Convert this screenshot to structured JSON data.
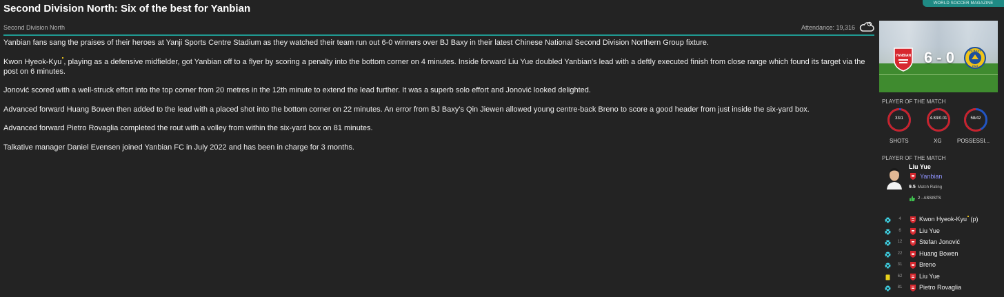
{
  "header": {
    "title": "Second Division North: Six of the best for Yanbian",
    "magazine_tag": "WORLD SOCCER MAGAZINE",
    "competition": "Second Division North",
    "attendance": "Attendance: 19,316",
    "weather_icon": "cloudy-weather-icon"
  },
  "article": {
    "paragraphs": [
      "Yanbian fans sang the praises of their heroes at Yanji Sports Centre Stadium as they watched their team run out 6-0 winners over BJ Baxy in their latest Chinese National Second Division Northern Group fixture.",
      {
        "before": "Kwon Hyeok-Kyu",
        "after": ", playing as a defensive midfielder, got Yanbian off to a flyer by scoring a penalty into the bottom corner on 4 minutes. Inside forward Liu Yue doubled Yanbian's lead with a deftly executed finish from close range which found its target via the post on 6 minutes."
      },
      "Jonović scored with a well-struck effort into the top corner from 20 metres in the 12th minute to extend the lead further. It was a superb solo effort and Jonović looked delighted.",
      "Advanced forward Huang Bowen then added to the lead with a placed shot into the bottom corner on 22 minutes. An error from BJ Baxy's Qin Jiewen allowed young centre-back Breno to score a good header from just inside the six-yard box.",
      "Advanced forward Pietro Rovaglia completed the rout with a volley from within the six-yard box on 81 minutes.",
      "Talkative manager Daniel Evensen joined Yanbian FC in July 2022 and has been in charge for 3 months."
    ]
  },
  "match_banner": {
    "score": "6 - 0",
    "home_crest_text": "YANBIAN",
    "away_crest_text_top": "FC BAXY",
    "away_crest_text_bottom": "2024",
    "home_color": "#d7282f",
    "away_color": "#1d4f9c"
  },
  "stats": {
    "heading": "PLAYER OF THE MATCH",
    "items": [
      {
        "value": "33/1",
        "label": "SHOTS",
        "home_share": 0.97
      },
      {
        "value": "4.83/0.01",
        "label": "XG",
        "home_share": 0.99
      },
      {
        "value": "58/42",
        "label": "POSSESSI...",
        "home_share": 0.58
      }
    ],
    "home_color": "#c8232b",
    "away_color": "#2255c4"
  },
  "potm": {
    "heading": "PLAYER OF THE MATCH",
    "name": "Liu Yue",
    "club": "Yanbian",
    "rating": "9.5",
    "rating_label": "Match Rating",
    "assists": "2 - ASSISTS"
  },
  "events": [
    {
      "minute": "4",
      "type": "goal",
      "player": "Kwon Hyeok-Kyu",
      "suffix": " (p)",
      "mark": true
    },
    {
      "minute": "6",
      "type": "goal",
      "player": "Liu Yue",
      "suffix": "",
      "mark": false
    },
    {
      "minute": "12",
      "type": "goal",
      "player": "Stefan Jonović",
      "suffix": "",
      "mark": false
    },
    {
      "minute": "22",
      "type": "goal",
      "player": "Huang Bowen",
      "suffix": "",
      "mark": false
    },
    {
      "minute": "31",
      "type": "goal",
      "player": "Breno",
      "suffix": "",
      "mark": false
    },
    {
      "minute": "62",
      "type": "yellow-card",
      "player": "Liu Yue",
      "suffix": "",
      "mark": false
    },
    {
      "minute": "81",
      "type": "goal",
      "player": "Pietro Rovaglia",
      "suffix": "",
      "mark": false
    }
  ]
}
